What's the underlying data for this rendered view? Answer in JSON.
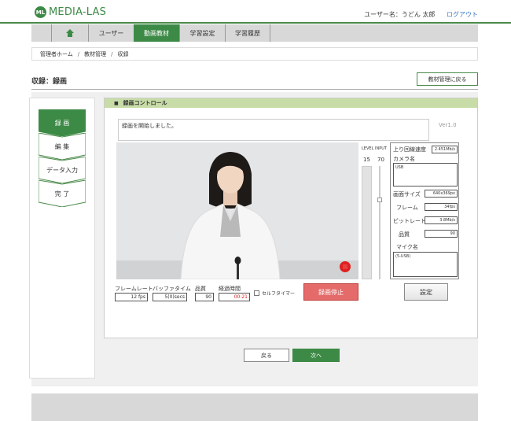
{
  "app": {
    "logo_mark": "ML",
    "logo_text": "MEDIA-LAS"
  },
  "user": {
    "label": "ユーザー名：うどん 太郎",
    "logout": "ログアウト"
  },
  "nav": {
    "home_icon": "home-icon",
    "tabs": [
      {
        "label": "ユーザー"
      },
      {
        "label": "動画教材"
      },
      {
        "label": "学習設定"
      },
      {
        "label": "学習履歴"
      }
    ]
  },
  "breadcrumb": {
    "items": [
      "管理者ホーム",
      "教材管理",
      "収録"
    ],
    "separator": "/"
  },
  "page": {
    "title": "収録：録画",
    "back_button": "教材管理に戻る"
  },
  "steps": [
    "録 画",
    "編 集",
    "データ入力",
    "完 了"
  ],
  "recording": {
    "header": "録画コントロール",
    "message": "録画を開始しました。",
    "version": "Ver1.0",
    "level_label": "LEVEL",
    "input_label": "INPUT",
    "level_value": "15",
    "input_value": "70"
  },
  "info": {
    "upload_speed_label": "上り回線速度",
    "upload_speed": "2.451Mb/s",
    "camera_name_label": "カメラ名",
    "camera_name": "USB",
    "screen_size_label": "画面サイズ",
    "screen_size": "640x369px",
    "frame_label": "フレーム",
    "frame": "34fps",
    "bitrate_label": "ビットレート",
    "bitrate": "3.8Mb/s",
    "quality_label": "品質",
    "quality": "90",
    "mic_name_label": "マイク名",
    "mic_name": "(5-USB)"
  },
  "controls": {
    "framerate_label": "フレームレート",
    "framerate": "12 fps",
    "buffer_label": "バッファタイム",
    "buffer": "5(0)secs",
    "quality_label": "品質",
    "quality": "90",
    "elapsed_label": "経過時間",
    "elapsed": "00:21",
    "self_timer_label": "セルフタイマー",
    "stop_button": "録画停止",
    "settings_button": "設定"
  },
  "footer_nav": {
    "back": "戻る",
    "next": "次へ"
  },
  "colors": {
    "brand": "#3d8a46",
    "header_bar": "#c8dca8",
    "stop": "#e56a6a",
    "rec": "#e02020"
  }
}
